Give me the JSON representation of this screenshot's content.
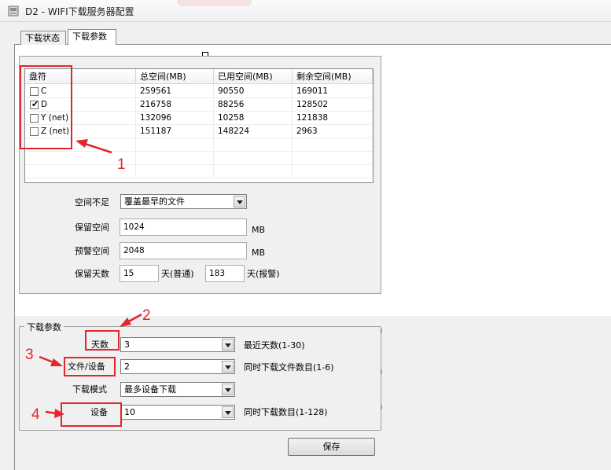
{
  "window": {
    "title": "D2 - WIFI下载服务器配置"
  },
  "tabs": [
    {
      "label": "下载状态",
      "active": false
    },
    {
      "label": "下载参数",
      "active": true
    }
  ],
  "disk_table": {
    "columns": [
      "盘符",
      "总空间(MB)",
      "已用空间(MB)",
      "剩余空间(MB)"
    ],
    "rows": [
      {
        "drive": "C",
        "checked": false,
        "total": "259561",
        "used": "90550",
        "free": "169011"
      },
      {
        "drive": "D",
        "checked": true,
        "total": "216758",
        "used": "88256",
        "free": "128502"
      },
      {
        "drive": "Y (net)",
        "checked": false,
        "total": "132096",
        "used": "10258",
        "free": "121838"
      },
      {
        "drive": "Z (net)",
        "checked": false,
        "total": "151187",
        "used": "148224",
        "free": "2963"
      }
    ]
  },
  "storage": {
    "insufficient_label": "空间不足",
    "insufficient_value": "覆盖最早的文件",
    "reserve_label": "保留空间",
    "reserve_value": "1024",
    "reserve_unit": "MB",
    "warn_label": "预警空间",
    "warn_value": "2048",
    "warn_unit": "MB",
    "keep_days_label": "保留天数",
    "keep_days_normal": "15",
    "keep_days_normal_unit": "天(普通)",
    "keep_days_alarm": "183",
    "keep_days_alarm_unit": "天(报警)"
  },
  "download": {
    "group_title": "下载参数",
    "days_label": "天数",
    "days_value": "3",
    "days_hint": "最近天数(1-30)",
    "files_label": "文件/设备",
    "files_value": "2",
    "files_hint": "同时下载文件数目(1-6)",
    "mode_label": "下载模式",
    "mode_value": "最多设备下载",
    "devices_label": "设备",
    "devices_value": "10",
    "devices_hint": "同时下载数目(1-128)"
  },
  "save_label": "保存",
  "annotations": [
    "1",
    "2",
    "3",
    "4"
  ],
  "colors": {
    "annotation": "#e2262b",
    "tab_border": "#898c95",
    "panel_bg": "#f0f0f0"
  },
  "icons": [
    "app-icon",
    "checkbox-check-icon",
    "dropdown-arrow-icon",
    "annotation-arrow-icon"
  ]
}
